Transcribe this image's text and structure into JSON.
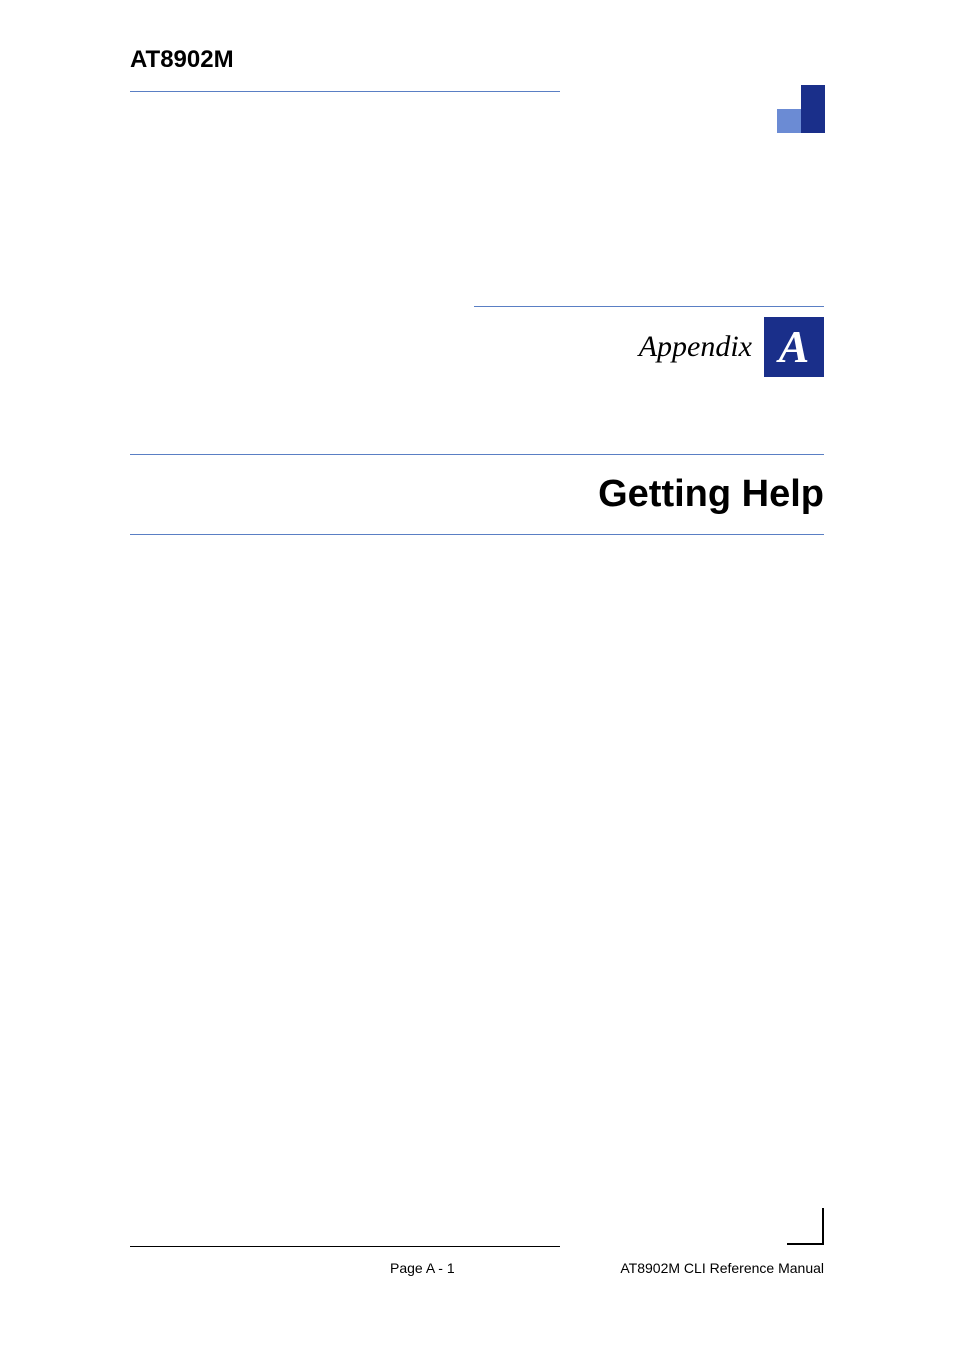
{
  "header": {
    "product": "AT8902M"
  },
  "appendix": {
    "label": "Appendix",
    "letter": "A"
  },
  "title": "Getting Help",
  "footer": {
    "page": "Page A - 1",
    "doc": "AT8902M CLI Reference Manual"
  }
}
